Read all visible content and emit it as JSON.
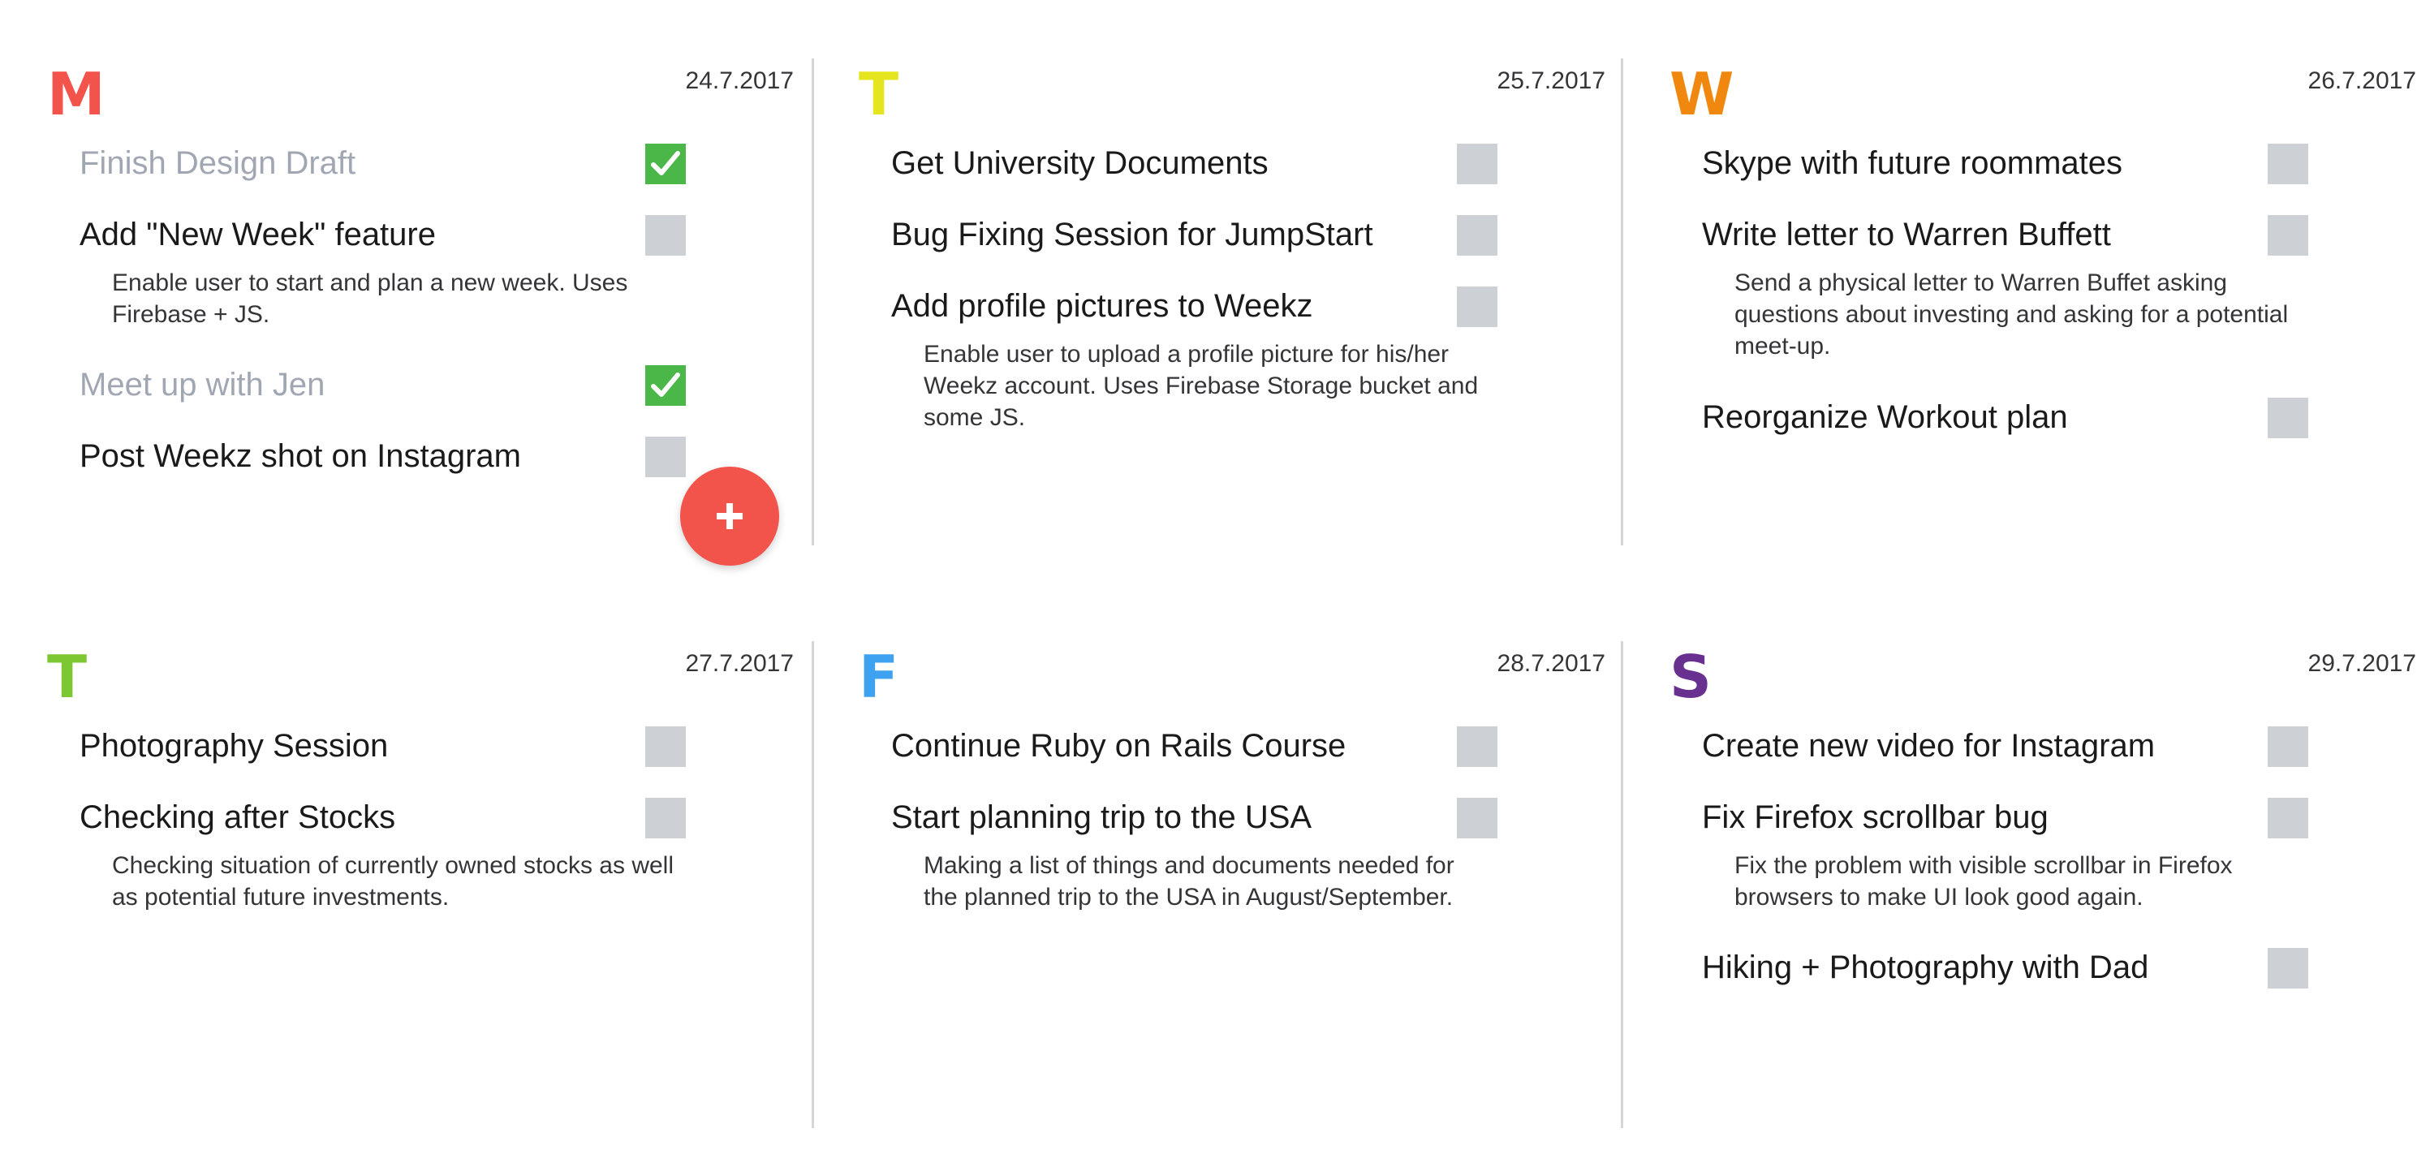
{
  "days": [
    {
      "letter": "M",
      "date": "24.7.2017",
      "color": "#f2534b",
      "tasks": [
        {
          "title": "Finish Design Draft",
          "done": true
        },
        {
          "title": "Add \"New Week\" feature",
          "done": false,
          "description": "Enable user to start and plan a new week. Uses Firebase + JS."
        },
        {
          "title": "Meet up with Jen",
          "done": true
        },
        {
          "title": "Post Weekz shot on Instagram",
          "done": false
        }
      ]
    },
    {
      "letter": "T",
      "date": "25.7.2017",
      "color": "#e5e51f",
      "tasks": [
        {
          "title": "Get University Documents",
          "done": false
        },
        {
          "title": "Bug Fixing Session for JumpStart",
          "done": false
        },
        {
          "title": "Add profile pictures to Weekz",
          "done": false,
          "description": "Enable user to upload a profile picture for his/her Weekz account. Uses Firebase Storage bucket and some JS."
        }
      ]
    },
    {
      "letter": "W",
      "date": "26.7.2017",
      "color": "#f0870f",
      "tasks": [
        {
          "title": "Skype with future roommates",
          "done": false
        },
        {
          "title": "Write letter to Warren Buffett",
          "done": false,
          "description": "Send a physical letter to Warren Buffet asking questions about investing and asking for a potential meet-up."
        },
        {
          "title": "Reorganize Workout plan",
          "done": false
        }
      ]
    },
    {
      "letter": "T",
      "date": "27.7.2017",
      "color": "#7dc832",
      "tasks": [
        {
          "title": "Photography Session",
          "done": false
        },
        {
          "title": "Checking after Stocks",
          "done": false,
          "description": "Checking situation of currently owned stocks as well as potential future investments."
        }
      ]
    },
    {
      "letter": "F",
      "date": "28.7.2017",
      "color": "#3fa2f0",
      "tasks": [
        {
          "title": "Continue Ruby on Rails Course",
          "done": false
        },
        {
          "title": "Start planning trip to the USA",
          "done": false,
          "description": "Making a list of things and documents needed for the planned trip to the USA in August/September."
        }
      ]
    },
    {
      "letter": "S",
      "date": "29.7.2017",
      "color": "#68308f",
      "tasks": [
        {
          "title": "Create new video for Instagram",
          "done": false
        },
        {
          "title": "Fix Firefox scrollbar bug",
          "done": false,
          "description": "Fix the problem with visible scrollbar in Firefox browsers to make UI look good again."
        },
        {
          "title": "Hiking + Photography with Dad",
          "done": false
        }
      ]
    }
  ],
  "colors": {
    "done_text": "#a0a7b3",
    "checkbox_empty": "#cdd0d5",
    "checkbox_checked": "#4cb749",
    "fab": "#f2534b",
    "divider": "#d4d6da"
  },
  "fab": {
    "icon": "plus-icon"
  }
}
